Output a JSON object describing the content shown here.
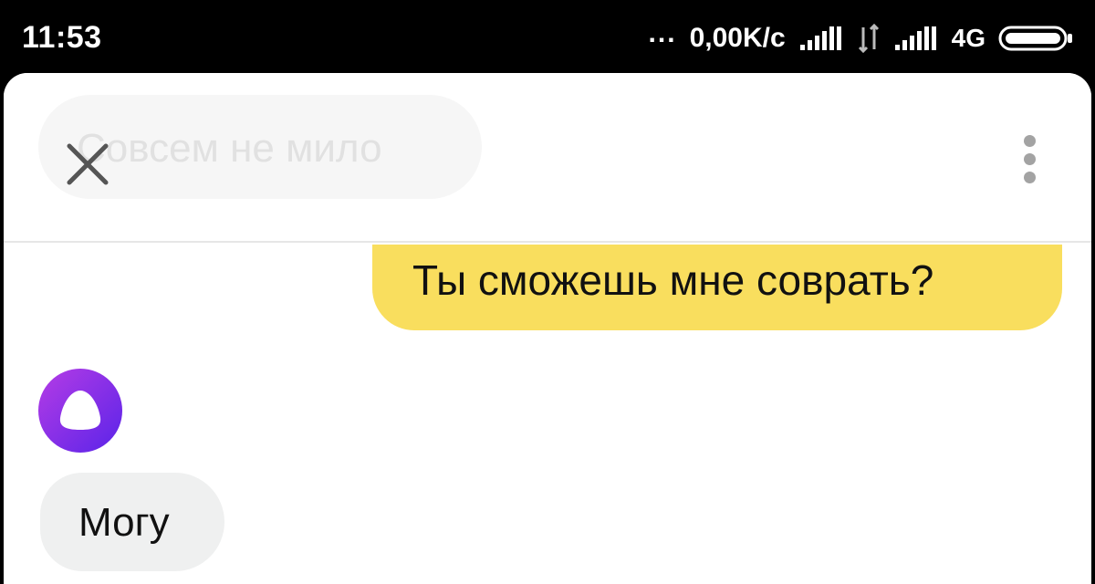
{
  "status_bar": {
    "time": "11:53",
    "dots": "...",
    "net_speed": "0,00K/c",
    "network_type": "4G"
  },
  "chat": {
    "title": "Совсем не мило",
    "messages": {
      "user_1": "Ты сможешь мне соврать?",
      "assistant_1": "Могу"
    }
  },
  "icons": {
    "close": "close-icon",
    "menu": "more-vert-icon",
    "avatar": "alice-icon"
  },
  "colors": {
    "user_bubble": "#f9de5e",
    "assistant_bubble": "#eff0f0",
    "avatar_accent": "#8a2be2"
  }
}
